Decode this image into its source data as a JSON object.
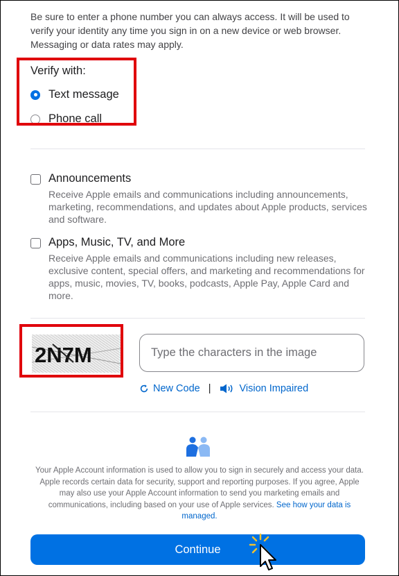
{
  "intro_text": "Be sure to enter a phone number you can always access. It will be used to verify your identity any time you sign in on a new device or web browser. Messaging or data rates may apply.",
  "verify": {
    "title": "Verify with:",
    "options": [
      {
        "label": "Text message",
        "checked": true
      },
      {
        "label": "Phone call",
        "checked": false
      }
    ]
  },
  "subscriptions": [
    {
      "title": "Announcements",
      "description": "Receive Apple emails and communications including announcements, marketing, recommendations, and updates about Apple products, services and software.",
      "checked": false
    },
    {
      "title": "Apps, Music, TV, and More",
      "description": "Receive Apple emails and communications including new releases, exclusive content, special offers, and marketing and recommendations for apps, music, movies, TV, books, podcasts, Apple Pay, Apple Card and more.",
      "checked": false
    }
  ],
  "captcha": {
    "code_text": "2N7M",
    "input_placeholder": "Type the characters in the image",
    "new_code_label": "New Code",
    "separator": "|",
    "vision_impaired_label": "Vision Impaired"
  },
  "privacy": {
    "text": "Your Apple Account information is used to allow you to sign in securely and access your data. Apple records certain data for security, support and reporting purposes. If you agree, Apple may also use your Apple Account information to send you marketing emails and communications, including based on your use of Apple services.",
    "link_label": "See how your data is managed."
  },
  "continue_label": "Continue",
  "colors": {
    "accent": "#0071e3",
    "link": "#0066cc",
    "highlight": "#e0000b"
  },
  "icons": [
    "refresh-icon",
    "speaker-icon",
    "people-handshake-icon",
    "pointer-cursor-icon"
  ]
}
